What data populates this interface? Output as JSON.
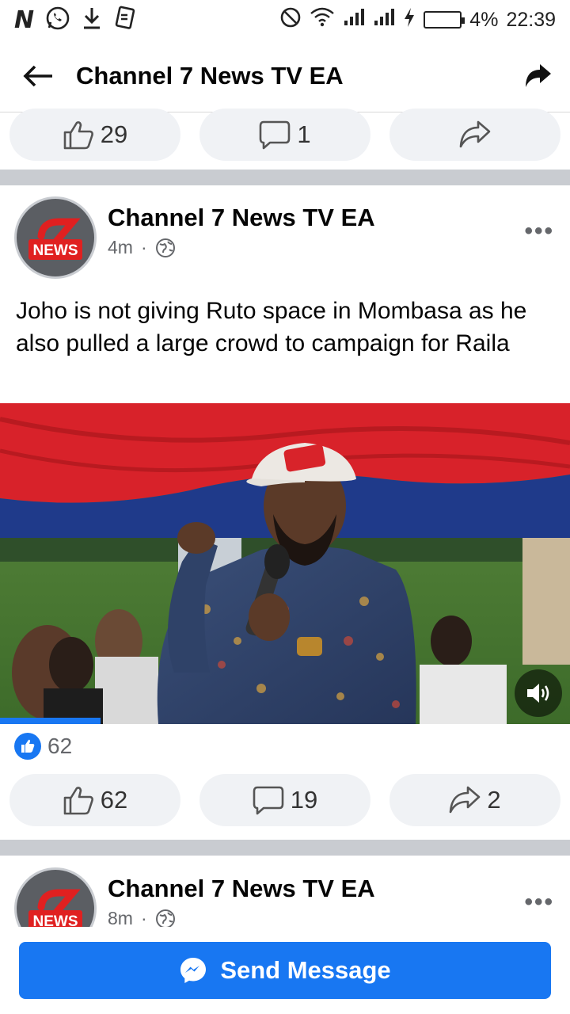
{
  "status_bar": {
    "carrier_logo": "N",
    "icons": [
      "whatsapp-icon",
      "download-icon",
      "sim-icon",
      "do-not-disturb-icon",
      "wifi-icon",
      "signal-icon",
      "signal-icon",
      "charging-icon",
      "battery-icon"
    ],
    "battery": "4%",
    "time": "22:39"
  },
  "header": {
    "title": "Channel 7 News TV EA"
  },
  "prev_post": {
    "likes": "29",
    "comments": "1"
  },
  "post": {
    "page_name": "Channel 7 News TV EA",
    "avatar_text": "NEWS",
    "time": "4m",
    "dot": "·",
    "text": "Joho is not giving Ruto space in Mombasa as he also pulled a large crowd to campaign for Raila",
    "video_progress": 0.176,
    "reaction_count": "62",
    "likes": "62",
    "comments": "19",
    "shares": "2"
  },
  "next_post": {
    "page_name": "Channel 7 News TV EA",
    "avatar_text": "NEWS",
    "time": "8m",
    "dot": "·"
  },
  "cta": {
    "label": "Send Message"
  },
  "colors": {
    "accent": "#1877f2",
    "button_bg": "#f0f2f5",
    "divider": "#c9ccd1",
    "meta_text": "#65676b"
  }
}
